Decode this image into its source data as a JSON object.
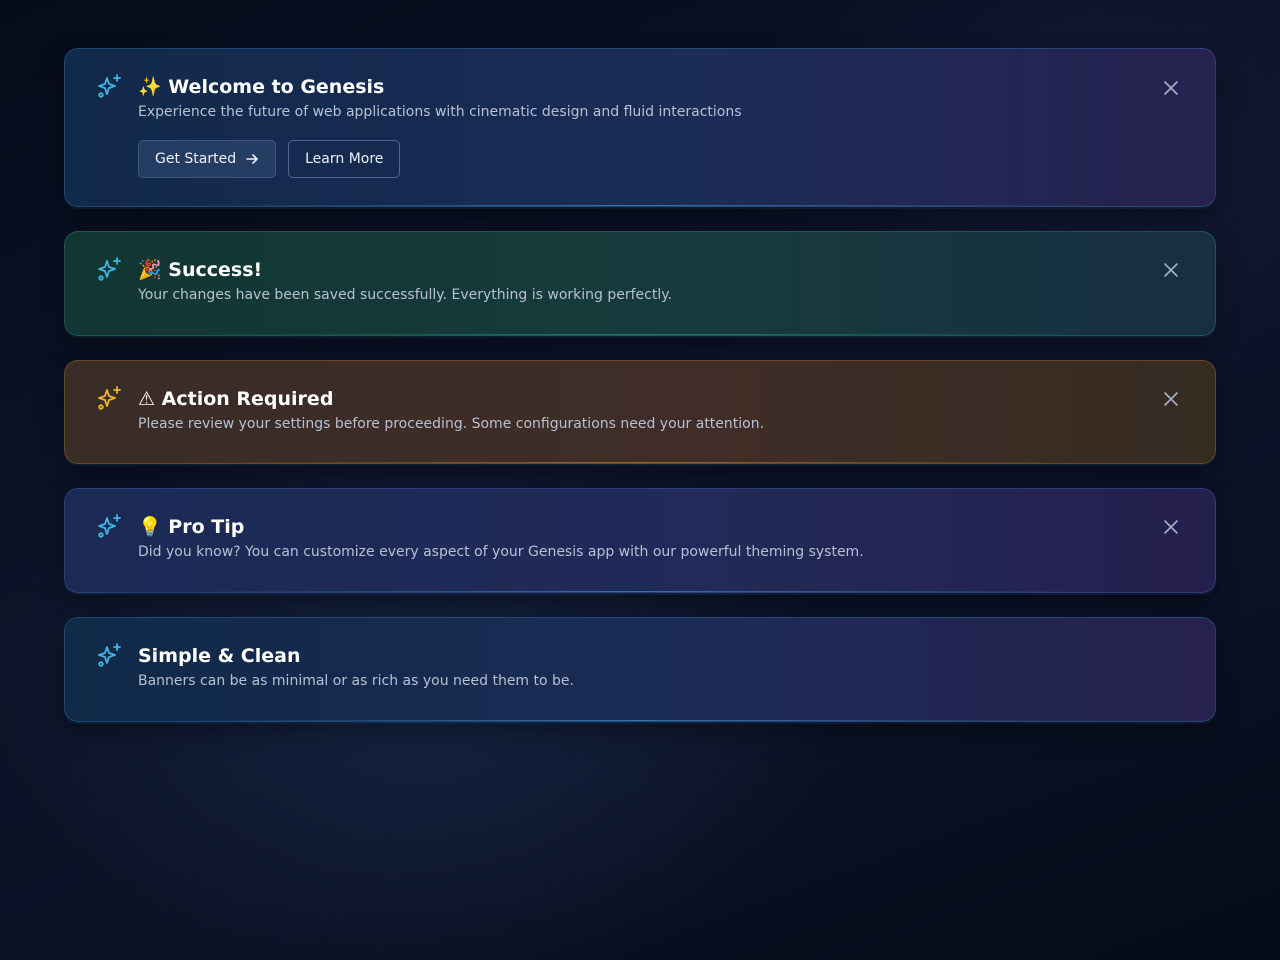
{
  "colors": {
    "icon_default": "#3fb6e6",
    "icon_warning": "#f0b429",
    "close_icon": "#a7b0c2"
  },
  "banners": [
    {
      "variant": "info",
      "icon": "sparkles-icon",
      "title": "✨ Welcome to Genesis",
      "description": "Experience the future of web applications with cinematic design and fluid interactions",
      "actions": {
        "primary_label": "Get Started",
        "primary_icon": "arrow-right-icon",
        "secondary_label": "Learn More"
      },
      "dismissible": true
    },
    {
      "variant": "success",
      "icon": "sparkles-icon",
      "title": "🎉 Success!",
      "description": "Your changes have been saved successfully. Everything is working perfectly.",
      "dismissible": true
    },
    {
      "variant": "warning",
      "icon": "sparkles-icon",
      "title": "⚠ Action Required",
      "description": "Please review your settings before proceeding. Some configurations need your attention.",
      "dismissible": true
    },
    {
      "variant": "tip",
      "icon": "sparkles-icon",
      "title": "💡 Pro Tip",
      "description": "Did you know? You can customize every aspect of your Genesis app with our powerful theming system.",
      "dismissible": true
    },
    {
      "variant": "plain",
      "icon": "sparkles-icon",
      "title": "Simple & Clean",
      "description": "Banners can be as minimal or as rich as you need them to be.",
      "dismissible": false
    }
  ]
}
